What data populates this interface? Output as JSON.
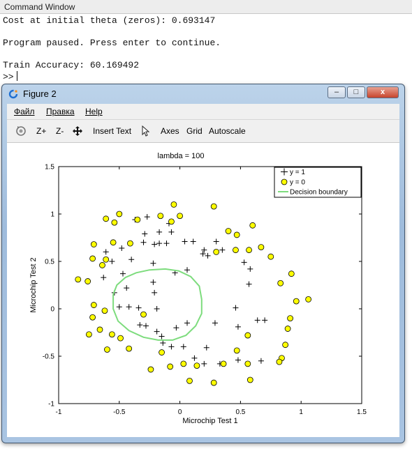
{
  "command_window": {
    "title": "Command Window",
    "lines": [
      "Cost at initial theta (zeros): 0.693147",
      "",
      "Program paused. Press enter to continue.",
      "",
      "Train Accuracy: 60.169492"
    ],
    "prompt": ">>"
  },
  "figure": {
    "title": "Figure 2",
    "window_buttons": {
      "minimize": "–",
      "maximize": "□",
      "close": "x"
    },
    "menu": [
      "Файл",
      "Правка",
      "Help"
    ],
    "toolbar": {
      "zoom_in": "Z+",
      "zoom_out": "Z-",
      "insert_text": "Insert Text",
      "axes": "Axes",
      "grid": "Grid",
      "autoscale": "Autoscale"
    }
  },
  "chart_data": {
    "type": "scatter",
    "title": "lambda = 100",
    "xlabel": "Microchip Test 1",
    "ylabel": "Microchip Test 2",
    "xlim": [
      -1,
      1.5
    ],
    "ylim": [
      -1,
      1.5
    ],
    "xticks": [
      "-1",
      "-0.5",
      "0",
      "0.5",
      "1",
      "1.5"
    ],
    "yticks": [
      "-1",
      "-0.5",
      "0",
      "0.5",
      "1",
      "1.5"
    ],
    "grid": false,
    "legend_position": "top-right",
    "legend": [
      "y = 1",
      "y = 0",
      "Decision boundary"
    ],
    "colors": {
      "positive": "#000000",
      "negative_fill": "#ffff00",
      "boundary": "#7ddc7d"
    },
    "positive": [
      [
        -0.27,
        0.97
      ],
      [
        -0.09,
        0.9
      ],
      [
        -0.37,
        0.94
      ],
      [
        -0.29,
        0.79
      ],
      [
        -0.17,
        0.81
      ],
      [
        -0.07,
        0.81
      ],
      [
        -0.3,
        0.7
      ],
      [
        -0.21,
        0.68
      ],
      [
        -0.17,
        0.69
      ],
      [
        -0.11,
        0.69
      ],
      [
        0.04,
        0.71
      ],
      [
        0.11,
        0.71
      ],
      [
        0.3,
        0.71
      ],
      [
        0.2,
        0.62
      ],
      [
        0.23,
        0.56
      ],
      [
        0.35,
        0.62
      ],
      [
        -0.48,
        0.64
      ],
      [
        -0.61,
        0.6
      ],
      [
        -0.4,
        0.52
      ],
      [
        -0.56,
        0.5
      ],
      [
        -0.22,
        0.48
      ],
      [
        0.19,
        0.58
      ],
      [
        0.53,
        0.49
      ],
      [
        0.58,
        0.42
      ],
      [
        0.57,
        0.26
      ],
      [
        0.06,
        0.41
      ],
      [
        -0.04,
        0.38
      ],
      [
        -0.47,
        0.37
      ],
      [
        -0.63,
        0.33
      ],
      [
        -0.22,
        0.28
      ],
      [
        -0.54,
        0.17
      ],
      [
        -0.44,
        0.22
      ],
      [
        -0.21,
        0.17
      ],
      [
        -0.5,
        0.02
      ],
      [
        -0.42,
        0.02
      ],
      [
        -0.34,
        0.01
      ],
      [
        -0.19,
        0.0
      ],
      [
        0.46,
        0.01
      ],
      [
        0.64,
        -0.12
      ],
      [
        0.7,
        -0.12
      ],
      [
        0.48,
        -0.19
      ],
      [
        0.29,
        -0.15
      ],
      [
        -0.33,
        -0.17
      ],
      [
        -0.28,
        -0.18
      ],
      [
        -0.19,
        -0.24
      ],
      [
        0.06,
        -0.15
      ],
      [
        -0.03,
        -0.2
      ],
      [
        -0.15,
        -0.29
      ],
      [
        -0.14,
        -0.36
      ],
      [
        -0.07,
        -0.4
      ],
      [
        0.03,
        -0.4
      ],
      [
        0.22,
        -0.41
      ],
      [
        0.12,
        -0.52
      ],
      [
        0.2,
        -0.58
      ],
      [
        0.48,
        -0.54
      ],
      [
        0.67,
        -0.55
      ],
      [
        0.33,
        -0.58
      ]
    ],
    "negative": [
      [
        -0.05,
        1.1
      ],
      [
        -0.5,
        1.0
      ],
      [
        -0.35,
        0.94
      ],
      [
        -0.16,
        0.98
      ],
      [
        0.0,
        0.98
      ],
      [
        0.28,
        1.08
      ],
      [
        -0.61,
        0.95
      ],
      [
        -0.54,
        0.91
      ],
      [
        -0.07,
        0.92
      ],
      [
        0.4,
        0.82
      ],
      [
        0.6,
        0.88
      ],
      [
        -0.71,
        0.68
      ],
      [
        -0.55,
        0.7
      ],
      [
        -0.41,
        0.69
      ],
      [
        0.47,
        0.78
      ],
      [
        0.57,
        0.62
      ],
      [
        0.67,
        0.65
      ],
      [
        0.46,
        0.62
      ],
      [
        0.3,
        0.6
      ],
      [
        -0.72,
        0.53
      ],
      [
        -0.61,
        0.52
      ],
      [
        -0.64,
        0.46
      ],
      [
        0.75,
        0.55
      ],
      [
        -0.84,
        0.31
      ],
      [
        -0.76,
        0.29
      ],
      [
        0.92,
        0.37
      ],
      [
        0.83,
        0.27
      ],
      [
        1.06,
        0.1
      ],
      [
        0.96,
        0.08
      ],
      [
        -0.71,
        0.04
      ],
      [
        -0.72,
        -0.09
      ],
      [
        0.91,
        -0.1
      ],
      [
        -0.62,
        -0.02
      ],
      [
        -0.66,
        -0.22
      ],
      [
        -0.3,
        -0.06
      ],
      [
        -0.75,
        -0.27
      ],
      [
        0.89,
        -0.21
      ],
      [
        -0.56,
        -0.27
      ],
      [
        -0.49,
        -0.31
      ],
      [
        0.56,
        -0.28
      ],
      [
        0.87,
        -0.38
      ],
      [
        -0.42,
        -0.42
      ],
      [
        -0.6,
        -0.43
      ],
      [
        -0.15,
        -0.46
      ],
      [
        0.47,
        -0.44
      ],
      [
        0.84,
        -0.52
      ],
      [
        0.03,
        -0.58
      ],
      [
        -0.24,
        -0.64
      ],
      [
        0.56,
        -0.58
      ],
      [
        0.82,
        -0.56
      ],
      [
        0.36,
        -0.58
      ],
      [
        -0.08,
        -0.61
      ],
      [
        0.14,
        -0.6
      ],
      [
        0.58,
        -0.75
      ],
      [
        0.08,
        -0.76
      ],
      [
        0.28,
        -0.78
      ]
    ],
    "boundary": [
      [
        -0.55,
        0.15
      ],
      [
        -0.52,
        0.25
      ],
      [
        -0.45,
        0.33
      ],
      [
        -0.36,
        0.38
      ],
      [
        -0.25,
        0.41
      ],
      [
        -0.12,
        0.42
      ],
      [
        -0.01,
        0.4
      ],
      [
        0.09,
        0.34
      ],
      [
        0.16,
        0.24
      ],
      [
        0.18,
        0.1
      ],
      [
        0.18,
        -0.05
      ],
      [
        0.13,
        -0.18
      ],
      [
        0.05,
        -0.28
      ],
      [
        -0.06,
        -0.33
      ],
      [
        -0.18,
        -0.33
      ],
      [
        -0.3,
        -0.3
      ],
      [
        -0.42,
        -0.23
      ],
      [
        -0.51,
        -0.13
      ],
      [
        -0.55,
        0.0
      ],
      [
        -0.55,
        0.15
      ]
    ]
  }
}
